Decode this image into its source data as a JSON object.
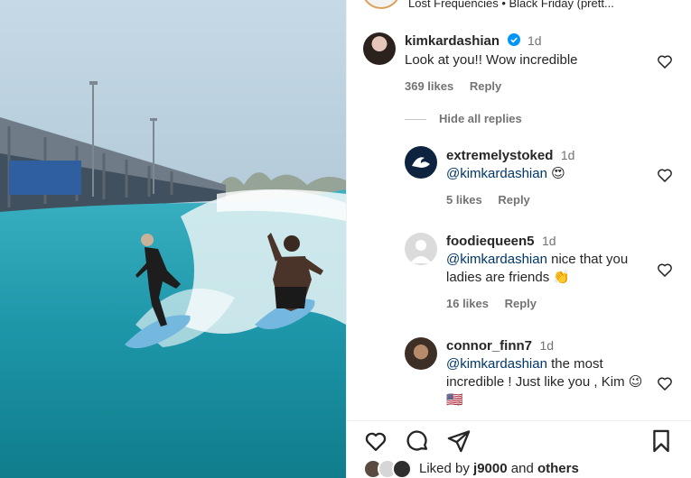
{
  "header": {
    "music": "Lost Frequencies • Black Friday (prett..."
  },
  "comments": [
    {
      "username": "kimkardashian",
      "time": "1d",
      "text": "Look at you!! Wow incredible",
      "likes": "369 likes",
      "reply": "Reply",
      "avatar_icon": "profile-photo-icon"
    }
  ],
  "hide_replies": "Hide all replies",
  "replies": [
    {
      "username": "extremelystoked",
      "time": "1d",
      "mention": "@kimkardashian",
      "text_after": " 😍",
      "likes": "5 likes",
      "reply": "Reply",
      "avatar_icon": "wave-logo-icon"
    },
    {
      "username": "foodiequeen5",
      "time": "1d",
      "mention": "@kimkardashian",
      "text_after": " nice that you ladies are friends 👏",
      "likes": "16 likes",
      "reply": "Reply",
      "avatar_icon": "default-avatar-icon"
    },
    {
      "username": "connor_finn7",
      "time": "1d",
      "mention": "@kimkardashian",
      "text_after": " the most incredible ! Just like you , Kim 😉 🇺🇸",
      "avatar_icon": "profile-photo-icon"
    }
  ],
  "likes_bar": {
    "prefix": "Liked by",
    "user": "j9000",
    "and": "and",
    "others": "others"
  },
  "colors": {
    "text": "#262626",
    "muted": "#737373",
    "mention": "#00376b",
    "verified": "#0095f6"
  }
}
